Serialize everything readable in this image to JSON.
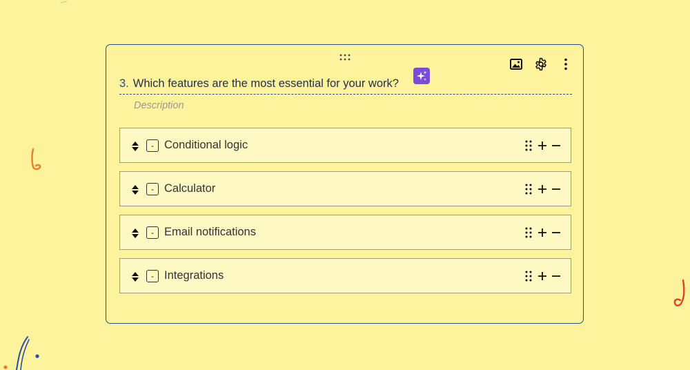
{
  "question": {
    "number": "3.",
    "title": "Which features are the most essential for your work?",
    "description_placeholder": "Description"
  },
  "toolbar": {
    "icons": [
      "image-icon",
      "gear-icon",
      "more-vertical-icon"
    ]
  },
  "choices": [
    {
      "label": "Conditional logic"
    },
    {
      "label": "Calculator"
    },
    {
      "label": "Email notifications"
    },
    {
      "label": "Integrations"
    }
  ],
  "choice_controls": {
    "minus_symbol": "-"
  },
  "colors": {
    "background": "#fdf39c",
    "card_border": "#2d4a8a",
    "choice_background": "#fef8c3",
    "ai_button": "#7b4bd9",
    "question_number": "#2a4b9b"
  }
}
